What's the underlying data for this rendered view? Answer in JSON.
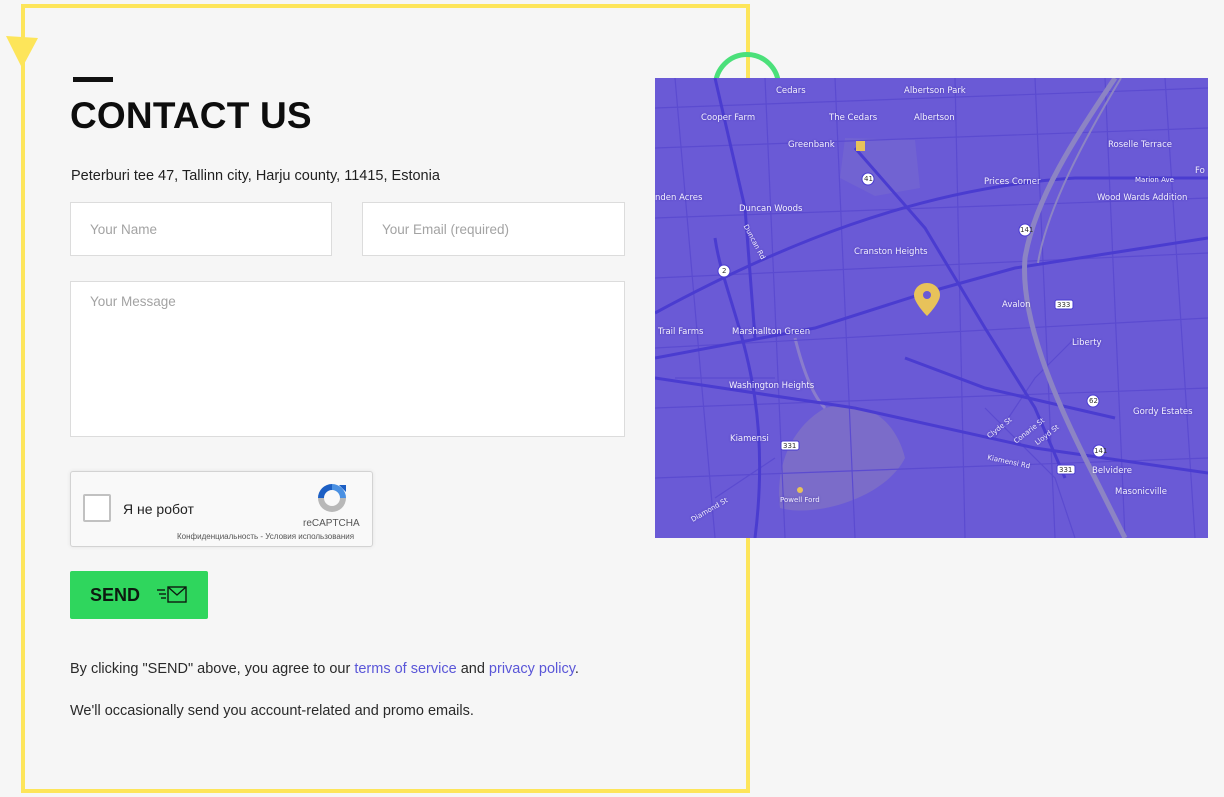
{
  "contact": {
    "title": "CONTACT US",
    "address": "Peterburi tee 47, Tallinn city, Harju county, 11415, Estonia"
  },
  "form": {
    "name_placeholder": "Your Name",
    "email_placeholder": "Your Email (required)",
    "message_placeholder": "Your Message",
    "name_value": "",
    "email_value": "",
    "message_value": ""
  },
  "captcha": {
    "label": "Я не робот",
    "brand": "reCAPTCHA",
    "links": "Конфиденциальность - Условия использования"
  },
  "send_button": {
    "label": "SEND",
    "icon": "envelope-icon"
  },
  "notice": {
    "prefix": "By clicking \"SEND\" above, you agree to our ",
    "terms_link": "terms of service",
    "middle": " and ",
    "privacy_link": "privacy policy",
    "suffix": ".",
    "promo": "We'll occasionally send you account-related and promo emails."
  },
  "map": {
    "marker": "map-pin-icon",
    "labels": {
      "cedars": "Cedars",
      "albertson_park": "Albertson Park",
      "cooper_farm": "Cooper Farm",
      "the_cedars": "The Cedars",
      "albertson": "Albertson",
      "greenbank": "Greenbank",
      "roselle_terrace": "Roselle Terrace",
      "marion_ave": "Marion Ave",
      "prices_corner": "Prices Corner",
      "wood_wards_addition": "Wood Wards Addition",
      "fo": "Fo",
      "linden_acres": "nden Acres",
      "duncan_woods": "Duncan Woods",
      "duncan_rd": "Duncan Rd",
      "cranston_heights": "Cranston Heights",
      "avalon": "Avalon",
      "trail_farms": "Trail Farms",
      "marshallton_green": "Marshallton Green",
      "liberty": "Liberty",
      "washington_heights": "Washington Heights",
      "gordy_estates": "Gordy Estates",
      "kiamensi": "Kiamensi",
      "clyde_st": "Clyde St",
      "conarie_st": "Conarie St",
      "lloyd_st": "Lloyd St",
      "kiamensi_rd": "Kiamensi Rd",
      "belvidere": "Belvidere",
      "powell_ford": "Powell Ford",
      "masonicville": "Masonicville",
      "diamond_st": "Diamond St",
      "rt_141_a": "141",
      "rt_141_b": "141",
      "rt_41": "41",
      "rt_2": "2",
      "rt_333": "333",
      "rt_62": "62",
      "rt_331": "331",
      "rt_331b": "331"
    }
  },
  "colors": {
    "frame": "#fde55a",
    "accent_green": "#2fd65d",
    "ring_green": "#4be07a",
    "map_bg": "#6a5ad6",
    "link": "#5a56d8",
    "marker": "#e8c25a"
  }
}
